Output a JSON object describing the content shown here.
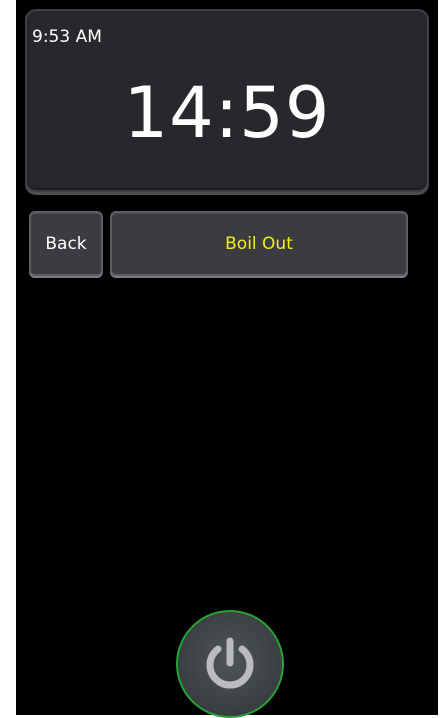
{
  "status": {
    "clock": "9:53 AM"
  },
  "timer": {
    "remaining": "14:59"
  },
  "controls": {
    "back_label": "Back",
    "step_label": "Boil Out",
    "power_icon": "power-icon"
  },
  "colors": {
    "background": "#000000",
    "panel": "#26282b",
    "step_text": "#f2ee1a",
    "power_ring": "#27a234"
  }
}
